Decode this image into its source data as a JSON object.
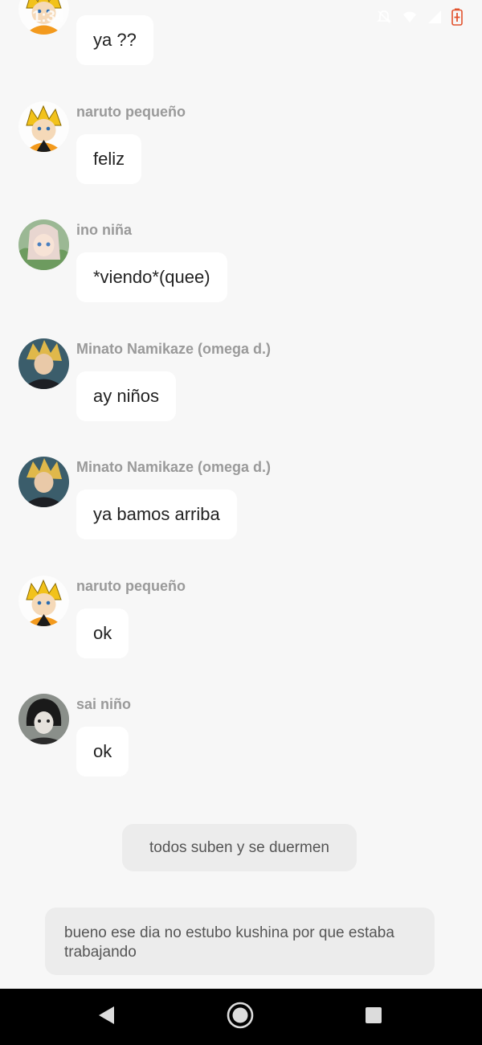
{
  "status_bar": {
    "time": "1:34",
    "icons": [
      "notifications-off-icon",
      "wifi-icon",
      "signal-icon",
      "battery-charging-icon"
    ],
    "battery_color": "#e2522d"
  },
  "messages": [
    {
      "sender": "",
      "text": "ya ??",
      "avatar": "naruto-pequeno"
    },
    {
      "sender": "naruto pequeño",
      "text": "feliz",
      "avatar": "naruto-pequeno"
    },
    {
      "sender": "ino niña",
      "text": "*viendo*(quee)",
      "avatar": "ino-nina"
    },
    {
      "sender": "Minato Namikaze (omega d.)",
      "text": "ay niños",
      "avatar": "minato"
    },
    {
      "sender": "Minato Namikaze (omega d.)",
      "text": "ya bamos arriba",
      "avatar": "minato"
    },
    {
      "sender": "naruto pequeño",
      "text": "ok",
      "avatar": "naruto-pequeno"
    },
    {
      "sender": "sai niño",
      "text": "ok",
      "avatar": "sai-nino"
    }
  ],
  "narration": {
    "center": "todos suben y se duermen",
    "wide": "bueno ese dia no estubo kushina por que estaba trabajando"
  },
  "nav_bar": {
    "buttons": [
      "back-icon",
      "home-icon",
      "recents-icon"
    ]
  }
}
